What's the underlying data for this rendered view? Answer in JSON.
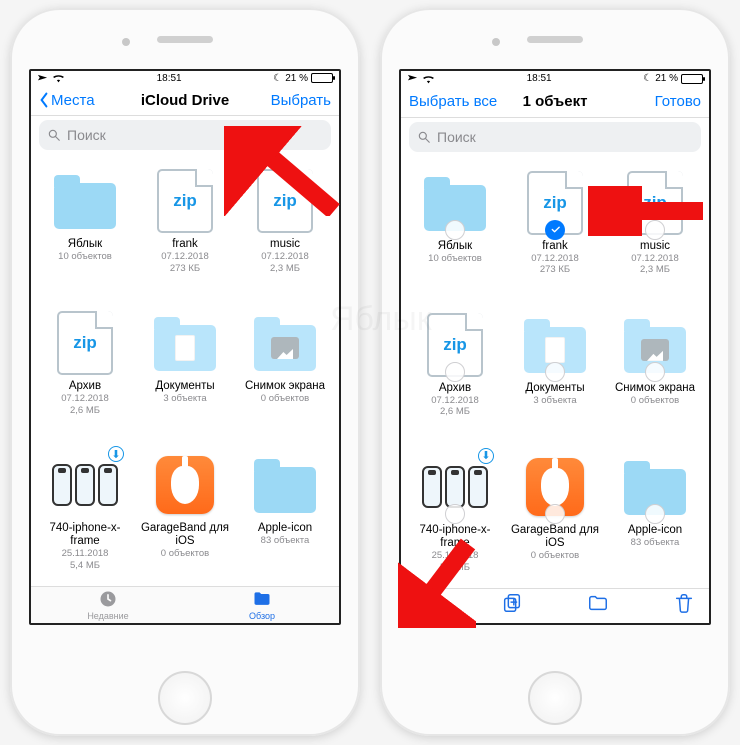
{
  "statusbar": {
    "time": "18:51",
    "battery_pct": "21 %"
  },
  "left_screen": {
    "nav": {
      "back_label": "Места",
      "title": "iCloud Drive",
      "right_label": "Выбрать"
    },
    "search_placeholder": "Поиск",
    "tabs": {
      "recent": "Недавние",
      "browse": "Обзор"
    }
  },
  "right_screen": {
    "nav": {
      "left_label": "Выбрать все",
      "title": "1 объект",
      "right_label": "Готово"
    },
    "search_placeholder": "Поиск"
  },
  "items": [
    {
      "kind": "folder",
      "name": "Яблык",
      "line1": "10 объектов",
      "line2": ""
    },
    {
      "kind": "zip",
      "name": "frank",
      "line1": "07.12.2018",
      "line2": "273 КБ"
    },
    {
      "kind": "zip",
      "name": "music",
      "line1": "07.12.2018",
      "line2": "2,3 МБ"
    },
    {
      "kind": "zip",
      "name": "Архив",
      "line1": "07.12.2018",
      "line2": "2,6 МБ"
    },
    {
      "kind": "folder-docs",
      "name": "Документы",
      "line1": "3 объекта",
      "line2": ""
    },
    {
      "kind": "folder-img",
      "name": "Снимок экрана",
      "line1": "0 объектов",
      "line2": ""
    },
    {
      "kind": "phones-thumb",
      "name": "740-iphone-x-frame",
      "line1": "25.11.2018",
      "line2": "5,4 МБ"
    },
    {
      "kind": "garageband",
      "name": "GarageBand для iOS",
      "line1": "0 объектов",
      "line2": ""
    },
    {
      "kind": "folder",
      "name": "Apple-icon",
      "line1": "83 объекта",
      "line2": ""
    }
  ],
  "selection": {
    "selected_index": 1
  }
}
